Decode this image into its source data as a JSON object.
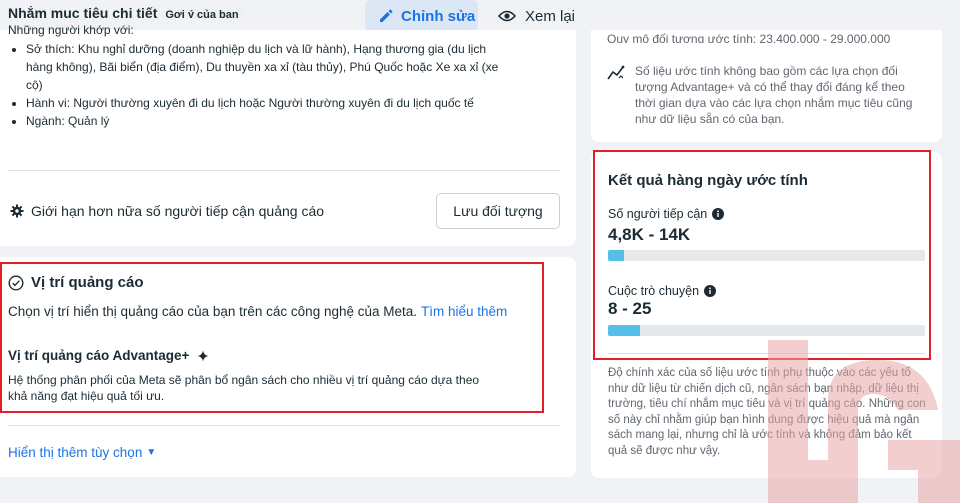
{
  "toolbar": {
    "edit_label": "Chỉnh sửa",
    "preview_label": "Xem lại"
  },
  "audience": {
    "title": "Nhắm mục tiêu chi tiết",
    "badge": "Gợi ý của bạn",
    "subtitle": "Những người khớp với:",
    "items": [
      "Sở thích: Khu nghỉ dưỡng (doanh nghiệp du lịch và lữ hành), Hạng thương gia (du lịch hàng không), Bãi biển (địa điểm), Du thuyền xa xỉ (tàu thủy), Phú Quốc hoặc Xe xa xỉ (xe cộ)",
      "Hành vi: Người thường xuyên đi du lịch hoặc Người thường xuyên đi du lịch quốc tế",
      "Ngành: Quản lý"
    ],
    "limit_label": "Giới hạn hơn nữa số người tiếp cận quảng cáo",
    "save_label": "Lưu đối tượng"
  },
  "placement": {
    "title": "Vị trí quảng cáo",
    "description": "Chọn vị trí hiển thị quảng cáo của bạn trên các công nghệ của Meta.",
    "learn_more": "Tìm hiểu thêm",
    "advantage_title": "Vị trí quảng cáo Advantage+",
    "advantage_desc": "Hệ thống phân phối của Meta sẽ phân bổ ngân sách cho nhiều vị trí quảng cáo dựa theo khả năng đạt hiệu quả tối ưu.",
    "more_options": "Hiển thị thêm tùy chọn"
  },
  "audience_size": {
    "clipped_text": "Quy mô đối tượng ước tính: 23.400.000 - 29.000.000",
    "note": "Số liệu ước tính không bao gồm các lựa chọn đối tượng Advantage+ và có thể thay đổi đáng kể theo thời gian dựa vào các lựa chọn nhắm mục tiêu cũng như dữ liệu sẵn có của bạn."
  },
  "daily_results": {
    "title": "Kết quả hàng ngày ước tính",
    "reach_label": "Số người tiếp cận",
    "reach_value": "4,8K - 14K",
    "reach_fill": 0.05,
    "conv_label": "Cuộc trò chuyện",
    "conv_value": "8 - 25",
    "conv_fill": 0.1,
    "disclaimer": "Độ chính xác của số liệu ước tính phụ thuộc vào các yếu tố như dữ liệu từ chiến dịch cũ, ngân sách bạn nhập, dữ liệu thị trường, tiêu chí nhắm mục tiêu và vị trí quảng cáo. Những con số này chỉ nhằm giúp bạn hình dung được hiệu quả mà ngân sách mang lại, nhưng chỉ là ước tính và không đảm bảo kết quả sẽ được như vậy."
  },
  "colors": {
    "accent": "#1b74e4",
    "highlight_border": "#e41e26",
    "bar_fill": "#55bfe9"
  }
}
